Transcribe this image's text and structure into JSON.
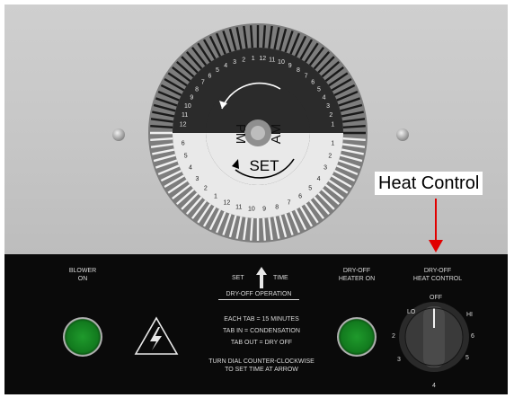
{
  "panel": {
    "callout": "Heat Control",
    "blower_label": "BLOWER\nON",
    "dryoff_heater_label": "DRY-OFF\nHEATER ON",
    "dryoff_heat_control_label": "DRY-OFF\nHEAT CONTROL",
    "set_label": "SET",
    "time_label": "TIME",
    "operation_title": "DRY-OFF OPERATION",
    "instructions": [
      "EACH TAB = 15 MINUTES",
      "TAB IN = CONDENSATION",
      "TAB OUT = DRY OFF"
    ],
    "turn_instruction": "TURN DIAL COUNTER-CLOCKWISE\nTO SET TIME AT ARROW",
    "colors": {
      "led": "#1c8f2a",
      "callout_arrow": "#e10000",
      "panel_black": "#0a0a0a"
    }
  },
  "dial": {
    "pm": "PM",
    "am": "AM",
    "set": "SET",
    "hours_top": [
      "12",
      "11",
      "10",
      "9",
      "8",
      "7",
      "6",
      "5",
      "4",
      "3",
      "2",
      "1",
      "12",
      "11",
      "10",
      "9",
      "8",
      "7",
      "6",
      "5",
      "4",
      "3",
      "2",
      "1"
    ],
    "hours_bottom": [
      "6",
      "5",
      "4",
      "3",
      "2",
      "1",
      "12",
      "11",
      "10",
      "9",
      "8",
      "7",
      "6",
      "5",
      "4",
      "3",
      "2",
      "1"
    ]
  },
  "knob": {
    "labels": {
      "off": "OFF",
      "lo": "LO",
      "hi": "HI",
      "n2": "2",
      "n3": "3",
      "n4": "4",
      "n5": "5",
      "n6": "6"
    }
  }
}
